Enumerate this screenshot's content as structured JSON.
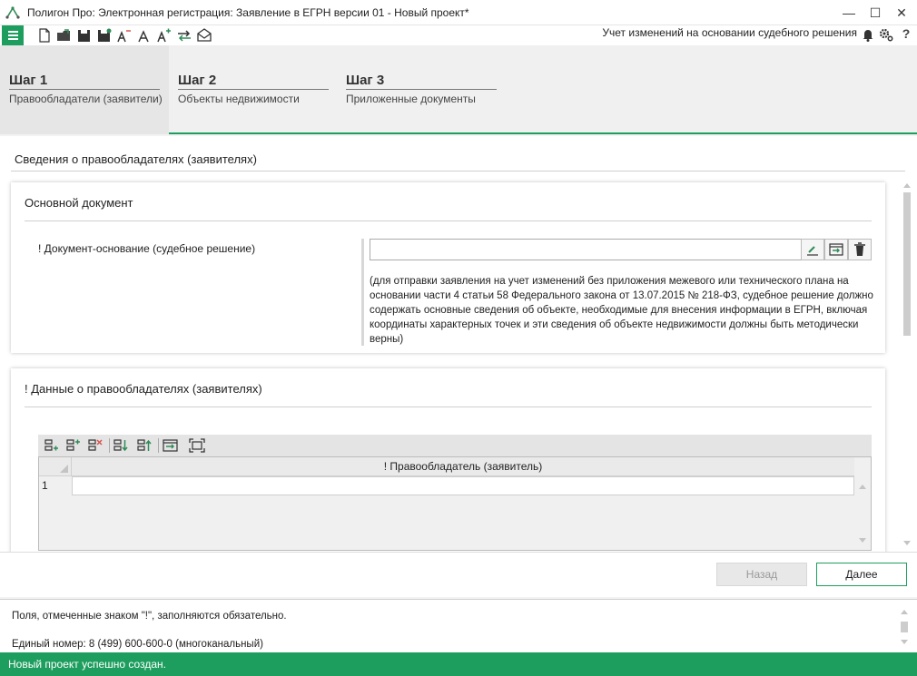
{
  "window": {
    "title": "Полигон Про: Электронная регистрация: Заявление в ЕГРН версии 01 - Новый проект*",
    "minimize": "—",
    "maximize": "☐",
    "close": "✕"
  },
  "toolbar": {
    "right_label": "Учет изменений на основании судебного решения",
    "icons": [
      "new-file-icon",
      "open-folder-icon",
      "save-icon",
      "save-as-icon",
      "font-decrease-icon",
      "font-normal-icon",
      "font-increase-icon",
      "swap-icon",
      "send-envelope-icon",
      "bell-icon",
      "settings-icon",
      "help-icon"
    ]
  },
  "steps": [
    {
      "num": "Шаг 1",
      "label": "Правообладатели (заявители)",
      "active": true
    },
    {
      "num": "Шаг 2",
      "label": "Объекты недвижимости",
      "active": false
    },
    {
      "num": "Шаг 3",
      "label": "Приложенные документы",
      "active": false
    }
  ],
  "main": {
    "section_title": "Сведения о правообладателях (заявителях)",
    "doc_card": {
      "title": "Основной документ",
      "field_label": "! Документ-основание (судебное решение)",
      "field_value": "",
      "help_text": "(для отправки заявления на учет изменений без приложения межевого или технического плана на основании части 4 статьи 58 Федерального закона от 13.07.2015 № 218-ФЗ, судебное решение должно содержать основные сведения об объекте, необходимые для внесения информации в ЕГРН, включая координаты характерных точек и эти сведения об объекте недвижимости должны быть методически верны)"
    },
    "holders_card": {
      "title": "! Данные о правообладателях (заявителях)",
      "grid": {
        "column": "! Правообладатель (заявитель)",
        "rows": [
          {
            "num": "1",
            "value": ""
          }
        ]
      }
    }
  },
  "footer": {
    "back_label": "Назад",
    "next_label": "Далее"
  },
  "info": {
    "line1": "Поля, отмеченные знаком \"!\", заполняются обязательно.",
    "line2": "Единый номер: 8 (499) 600-600-0 (многоканальный)"
  },
  "status": {
    "text": "Новый проект успешно создан."
  },
  "colors": {
    "accent": "#1e9e5e",
    "icon_green": "#2e8b57",
    "icon_red": "#d9534f"
  }
}
